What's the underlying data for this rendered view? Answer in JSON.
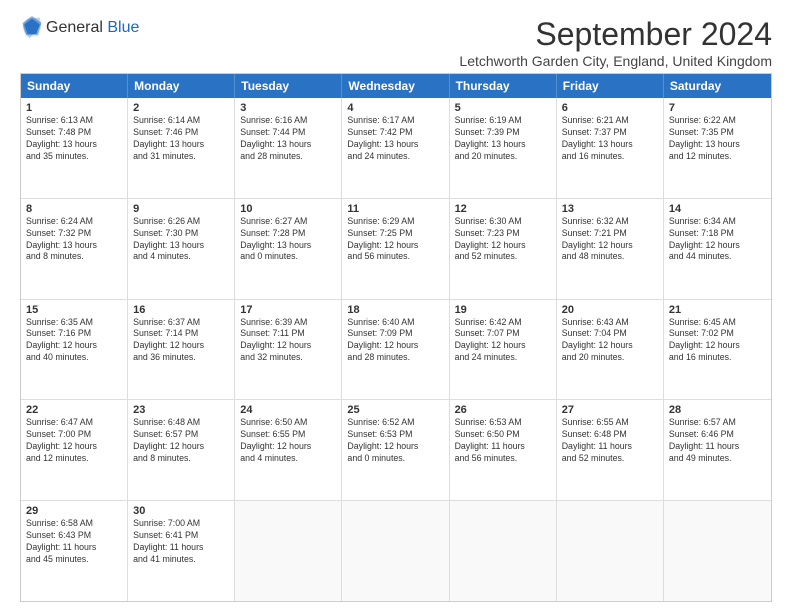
{
  "header": {
    "logo": {
      "line1": "General",
      "line2": "Blue"
    },
    "title": "September 2024",
    "location": "Letchworth Garden City, England, United Kingdom"
  },
  "calendar": {
    "weekdays": [
      "Sunday",
      "Monday",
      "Tuesday",
      "Wednesday",
      "Thursday",
      "Friday",
      "Saturday"
    ],
    "rows": [
      [
        {
          "day": "1",
          "info": "Sunrise: 6:13 AM\nSunset: 7:48 PM\nDaylight: 13 hours\nand 35 minutes."
        },
        {
          "day": "2",
          "info": "Sunrise: 6:14 AM\nSunset: 7:46 PM\nDaylight: 13 hours\nand 31 minutes."
        },
        {
          "day": "3",
          "info": "Sunrise: 6:16 AM\nSunset: 7:44 PM\nDaylight: 13 hours\nand 28 minutes."
        },
        {
          "day": "4",
          "info": "Sunrise: 6:17 AM\nSunset: 7:42 PM\nDaylight: 13 hours\nand 24 minutes."
        },
        {
          "day": "5",
          "info": "Sunrise: 6:19 AM\nSunset: 7:39 PM\nDaylight: 13 hours\nand 20 minutes."
        },
        {
          "day": "6",
          "info": "Sunrise: 6:21 AM\nSunset: 7:37 PM\nDaylight: 13 hours\nand 16 minutes."
        },
        {
          "day": "7",
          "info": "Sunrise: 6:22 AM\nSunset: 7:35 PM\nDaylight: 13 hours\nand 12 minutes."
        }
      ],
      [
        {
          "day": "8",
          "info": "Sunrise: 6:24 AM\nSunset: 7:32 PM\nDaylight: 13 hours\nand 8 minutes."
        },
        {
          "day": "9",
          "info": "Sunrise: 6:26 AM\nSunset: 7:30 PM\nDaylight: 13 hours\nand 4 minutes."
        },
        {
          "day": "10",
          "info": "Sunrise: 6:27 AM\nSunset: 7:28 PM\nDaylight: 13 hours\nand 0 minutes."
        },
        {
          "day": "11",
          "info": "Sunrise: 6:29 AM\nSunset: 7:25 PM\nDaylight: 12 hours\nand 56 minutes."
        },
        {
          "day": "12",
          "info": "Sunrise: 6:30 AM\nSunset: 7:23 PM\nDaylight: 12 hours\nand 52 minutes."
        },
        {
          "day": "13",
          "info": "Sunrise: 6:32 AM\nSunset: 7:21 PM\nDaylight: 12 hours\nand 48 minutes."
        },
        {
          "day": "14",
          "info": "Sunrise: 6:34 AM\nSunset: 7:18 PM\nDaylight: 12 hours\nand 44 minutes."
        }
      ],
      [
        {
          "day": "15",
          "info": "Sunrise: 6:35 AM\nSunset: 7:16 PM\nDaylight: 12 hours\nand 40 minutes."
        },
        {
          "day": "16",
          "info": "Sunrise: 6:37 AM\nSunset: 7:14 PM\nDaylight: 12 hours\nand 36 minutes."
        },
        {
          "day": "17",
          "info": "Sunrise: 6:39 AM\nSunset: 7:11 PM\nDaylight: 12 hours\nand 32 minutes."
        },
        {
          "day": "18",
          "info": "Sunrise: 6:40 AM\nSunset: 7:09 PM\nDaylight: 12 hours\nand 28 minutes."
        },
        {
          "day": "19",
          "info": "Sunrise: 6:42 AM\nSunset: 7:07 PM\nDaylight: 12 hours\nand 24 minutes."
        },
        {
          "day": "20",
          "info": "Sunrise: 6:43 AM\nSunset: 7:04 PM\nDaylight: 12 hours\nand 20 minutes."
        },
        {
          "day": "21",
          "info": "Sunrise: 6:45 AM\nSunset: 7:02 PM\nDaylight: 12 hours\nand 16 minutes."
        }
      ],
      [
        {
          "day": "22",
          "info": "Sunrise: 6:47 AM\nSunset: 7:00 PM\nDaylight: 12 hours\nand 12 minutes."
        },
        {
          "day": "23",
          "info": "Sunrise: 6:48 AM\nSunset: 6:57 PM\nDaylight: 12 hours\nand 8 minutes."
        },
        {
          "day": "24",
          "info": "Sunrise: 6:50 AM\nSunset: 6:55 PM\nDaylight: 12 hours\nand 4 minutes."
        },
        {
          "day": "25",
          "info": "Sunrise: 6:52 AM\nSunset: 6:53 PM\nDaylight: 12 hours\nand 0 minutes."
        },
        {
          "day": "26",
          "info": "Sunrise: 6:53 AM\nSunset: 6:50 PM\nDaylight: 11 hours\nand 56 minutes."
        },
        {
          "day": "27",
          "info": "Sunrise: 6:55 AM\nSunset: 6:48 PM\nDaylight: 11 hours\nand 52 minutes."
        },
        {
          "day": "28",
          "info": "Sunrise: 6:57 AM\nSunset: 6:46 PM\nDaylight: 11 hours\nand 49 minutes."
        }
      ],
      [
        {
          "day": "29",
          "info": "Sunrise: 6:58 AM\nSunset: 6:43 PM\nDaylight: 11 hours\nand 45 minutes."
        },
        {
          "day": "30",
          "info": "Sunrise: 7:00 AM\nSunset: 6:41 PM\nDaylight: 11 hours\nand 41 minutes."
        },
        {
          "day": "",
          "info": ""
        },
        {
          "day": "",
          "info": ""
        },
        {
          "day": "",
          "info": ""
        },
        {
          "day": "",
          "info": ""
        },
        {
          "day": "",
          "info": ""
        }
      ]
    ]
  }
}
